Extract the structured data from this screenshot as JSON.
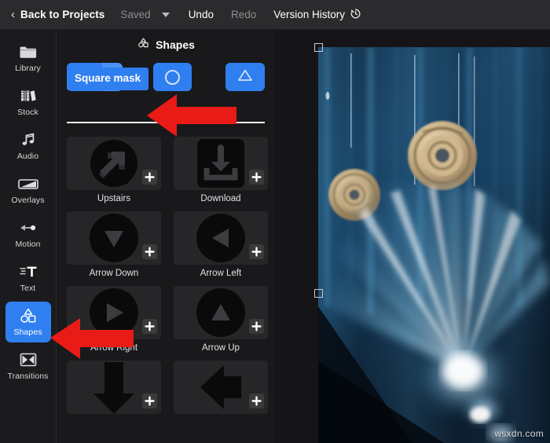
{
  "topbar": {
    "back_label": "Back to Projects",
    "back_icon": "chevron-left-icon",
    "saved_label": "Saved",
    "caret_icon": "caret-down-icon",
    "undo_label": "Undo",
    "redo_label": "Redo",
    "version_history_label": "Version History",
    "version_history_icon": "history-clock-icon",
    "bg_color": "#2b2b2d",
    "text_color": "#ffffff",
    "dim_text_color": "#8d8d90"
  },
  "sidebar": {
    "active_index": 6,
    "active_color": "#2f7ff0",
    "items": [
      {
        "label": "Library",
        "icon": "folder-icon"
      },
      {
        "label": "Stock",
        "icon": "books-icon"
      },
      {
        "label": "Audio",
        "icon": "music-note-icon"
      },
      {
        "label": "Overlays",
        "icon": "overlays-icon"
      },
      {
        "label": "Motion",
        "icon": "motion-icon"
      },
      {
        "label": "Text",
        "icon": "text-icon"
      },
      {
        "label": "Shapes",
        "icon": "shapes-icon"
      },
      {
        "label": "Transitions",
        "icon": "transitions-icon"
      }
    ]
  },
  "panel": {
    "title": "Shapes",
    "title_icon": "shapes-icon",
    "tools": [
      {
        "name": "square-mask-tool",
        "icon": "square-outline-icon",
        "active": true,
        "has_caret": true
      },
      {
        "name": "circle-mask-tool",
        "icon": "circle-outline-icon",
        "active": true,
        "has_caret": false
      },
      {
        "name": "triangle-mask-tool",
        "icon": "triangle-outline-icon",
        "active": true,
        "has_caret": false
      }
    ],
    "dropdown": {
      "label": "Square mask",
      "bg_color": "#2f7ff0",
      "open": true
    },
    "shapes": [
      {
        "label": "Upstairs",
        "icon": "upstairs-arrow-icon",
        "add_icon": "plus-icon"
      },
      {
        "label": "Download",
        "icon": "download-tray-icon",
        "add_icon": "plus-icon"
      },
      {
        "label": "Arrow Down",
        "icon": "arrow-down-circle-icon",
        "add_icon": "plus-icon"
      },
      {
        "label": "Arrow Left",
        "icon": "arrow-left-circle-icon",
        "add_icon": "plus-icon"
      },
      {
        "label": "Arrow Right",
        "icon": "arrow-right-circle-icon",
        "add_icon": "plus-icon"
      },
      {
        "label": "Arrow Up",
        "icon": "arrow-up-circle-icon",
        "add_icon": "plus-icon"
      },
      {
        "label": "",
        "icon": "fat-arrow-down-icon",
        "add_icon": "plus-icon"
      },
      {
        "label": "",
        "icon": "fat-arrow-left-icon",
        "add_icon": "plus-icon"
      }
    ]
  },
  "preview": {
    "watermark": "wsxdn.com",
    "selection_handles": [
      "top-left-handle",
      "mid-left-handle"
    ],
    "bg_color": "#151517"
  },
  "annotations": {
    "arrow_color": "#e81b17",
    "arrows": [
      "tooltip-pointer-arrow",
      "sidebar-pointer-arrow"
    ]
  }
}
